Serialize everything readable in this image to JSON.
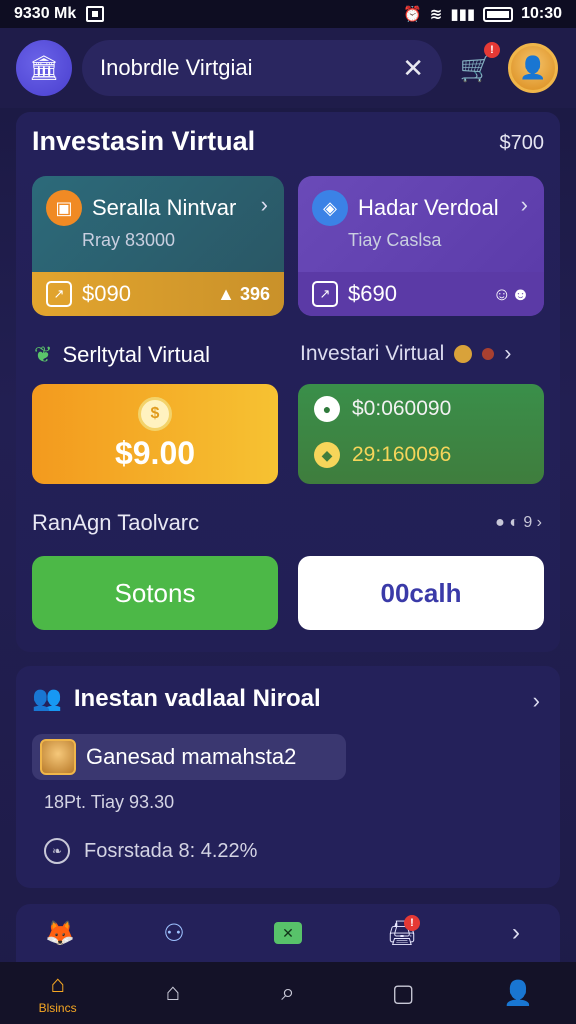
{
  "status_bar": {
    "left_text": "9330 Mk",
    "time": "10:30"
  },
  "header": {
    "search_text": "Inobrdle Virtgiai",
    "cart_badge": "!"
  },
  "overview": {
    "title": "Investasin Virtual",
    "amount": "$700",
    "tile_a": {
      "title": "Seralla Nintvar",
      "sub": "Rray 83000",
      "value": "$090",
      "right": "396"
    },
    "tile_b": {
      "title": "Hadar Verdoal",
      "sub": "Tiay Caslsa",
      "value": "$690"
    },
    "row2_left": "Serltytal Virtual",
    "row2_right": "Investari Virtual",
    "gold_value": "$9.00",
    "green_row1": "$0:060090",
    "green_row2": "29:160096",
    "ranking": "RanAgn Taolvarc",
    "rank_right": "9",
    "btn_green": "Sotons",
    "btn_white": "00calh"
  },
  "second": {
    "title": "Inestan vadlaal Niroal",
    "user_name": "Ganesad mamahsta2",
    "line1": "18Pt. Tiay 93.30",
    "line2": "Fosrstada 8: 4.22%"
  },
  "bottom_nav": {
    "home_label": "Blsincs"
  },
  "colors": {
    "accent_orange": "#f5a623",
    "green": "#4cb847",
    "purple": "#6a4ab8",
    "background": "#1f1c4a"
  }
}
